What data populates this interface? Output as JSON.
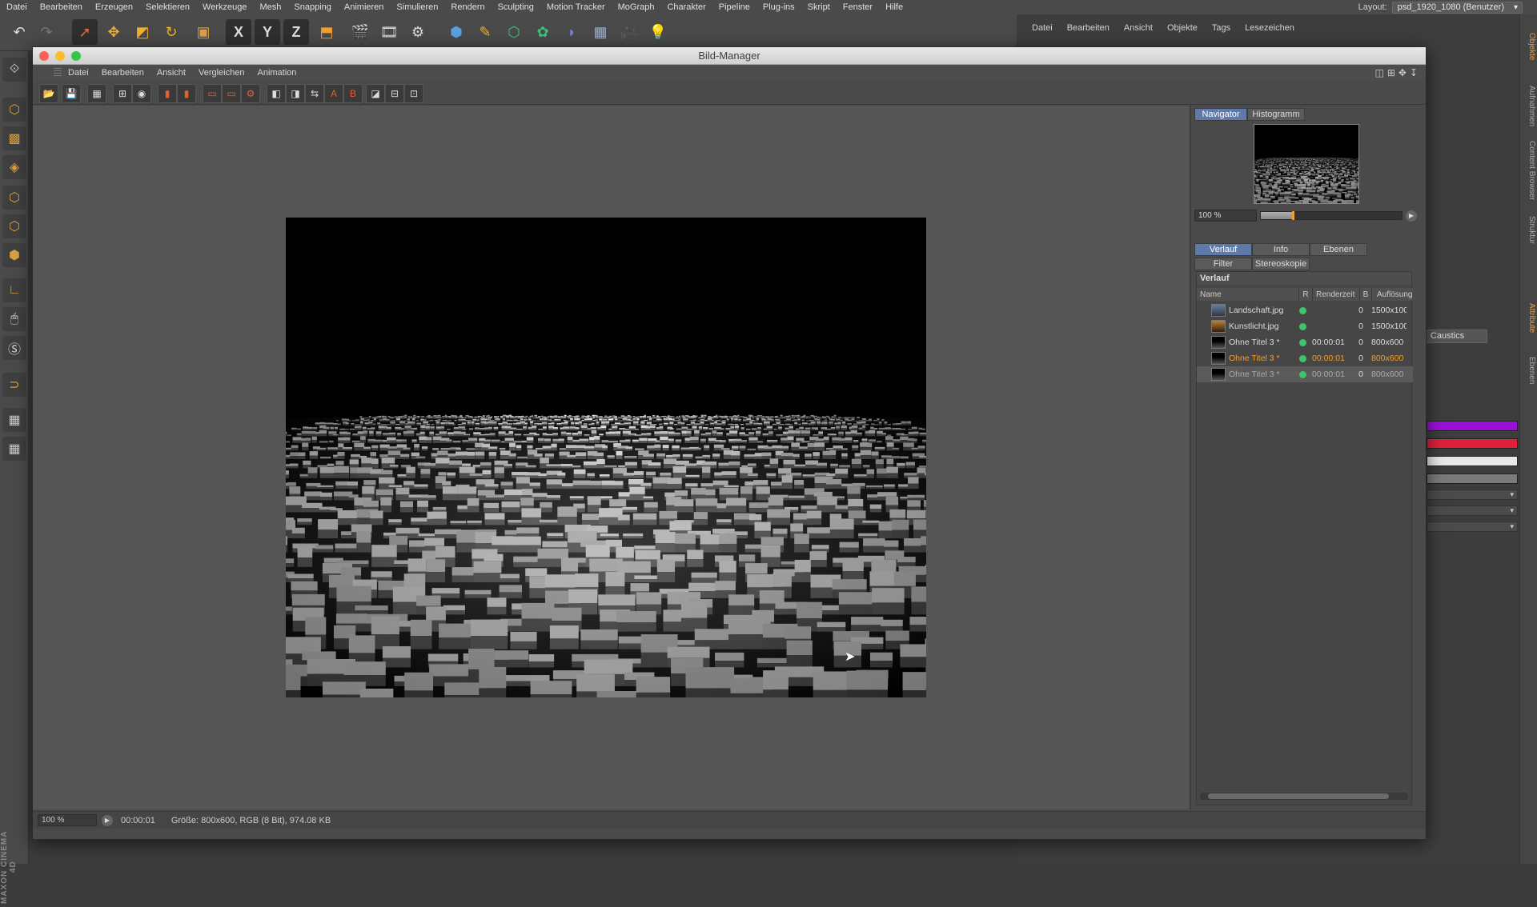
{
  "main_menu": {
    "items": [
      "Datei",
      "Bearbeiten",
      "Erzeugen",
      "Selektieren",
      "Werkzeuge",
      "Mesh",
      "Snapping",
      "Animieren",
      "Simulieren",
      "Rendern",
      "Sculpting",
      "Motion Tracker",
      "MoGraph",
      "Charakter",
      "Pipeline",
      "Plug-ins",
      "Skript",
      "Fenster",
      "Hilfe"
    ],
    "layout_label": "Layout:",
    "layout_value": "psd_1920_1080 (Benutzer)"
  },
  "toolbar": {
    "axis_x": "X",
    "axis_y": "Y",
    "axis_z": "Z"
  },
  "object_manager": {
    "menu": [
      "Datei",
      "Bearbeiten",
      "Ansicht",
      "Objekte",
      "Tags",
      "Lesezeichen"
    ]
  },
  "right_strip": {
    "tabs": [
      "Objekte",
      "Aufnahmen",
      "Content Browser",
      "Struktur"
    ],
    "lower_tabs": [
      "Attribute",
      "Ebenen"
    ]
  },
  "attributes": {
    "caustics_label": "Caustics",
    "colors": [
      "#9a10d8",
      "#e0203a",
      "#e8e8e8",
      "#7a7a7a"
    ]
  },
  "bild_manager": {
    "title": "Bild-Manager",
    "menu": [
      "Datei",
      "Bearbeiten",
      "Ansicht",
      "Vergleichen",
      "Animation"
    ],
    "tabs_top": [
      "Navigator",
      "Histogramm"
    ],
    "zoom_value": "100 %",
    "zoom_fraction": 0.22,
    "tabs_lower_row1": [
      "Verlauf",
      "Info",
      "Ebenen"
    ],
    "tabs_lower_row2": [
      "Filter",
      "Stereoskopie"
    ],
    "history_title": "Verlauf",
    "history_columns": {
      "name": "Name",
      "r": "R",
      "time": "Renderzeit",
      "b": "B",
      "res": "Auflösung"
    },
    "history_rows": [
      {
        "name": "Landschaft.jpg",
        "time": "",
        "b": "0",
        "res": "1500x1000"
      },
      {
        "name": "Kunstlicht.jpg",
        "time": "",
        "b": "0",
        "res": "1500x1000"
      },
      {
        "name": "Ohne Titel 3 *",
        "time": "00:00:01",
        "b": "0",
        "res": "800x600"
      },
      {
        "name": "Ohne Titel 3 *",
        "time": "00:00:01",
        "b": "0",
        "res": "800x600"
      },
      {
        "name": "Ohne Titel 3 *",
        "time": "00:00:01",
        "b": "0",
        "res": "800x600"
      }
    ],
    "status": {
      "zoom": "100 %",
      "time": "00:00:01",
      "info": "Größe: 800x600, RGB (8 Bit), 974.08 KB"
    }
  },
  "logo": {
    "text": "MAXON CINEMA 4D"
  }
}
